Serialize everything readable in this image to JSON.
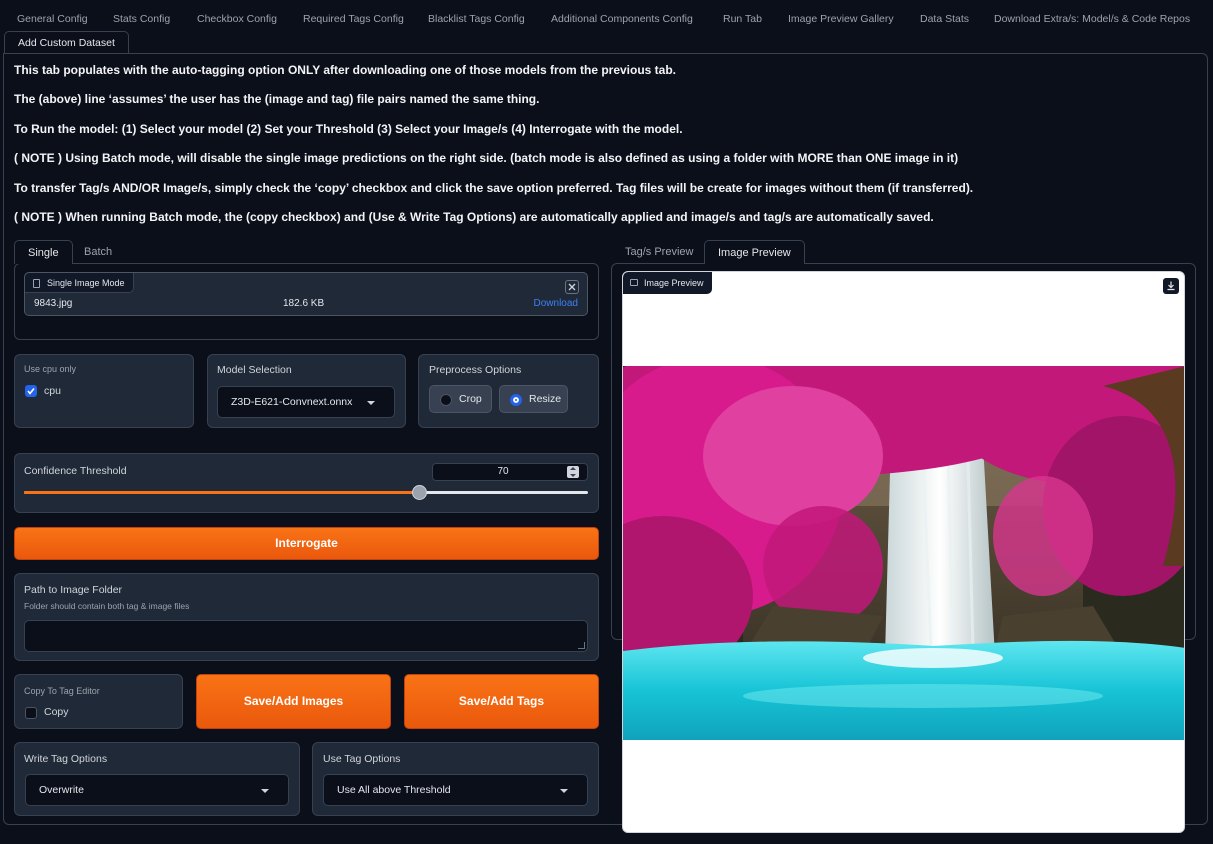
{
  "top_tabs": [
    {
      "label": "General Config",
      "active": false
    },
    {
      "label": "Stats Config",
      "active": false
    },
    {
      "label": "Checkbox Config",
      "active": false
    },
    {
      "label": "Required Tags Config",
      "active": false
    },
    {
      "label": "Blacklist Tags Config",
      "active": false
    },
    {
      "label": "Additional Components Config",
      "active": false
    },
    {
      "label": "Run Tab",
      "active": false
    },
    {
      "label": "Image Preview Gallery",
      "active": false
    },
    {
      "label": "Data Stats",
      "active": false
    },
    {
      "label": "Download Extra/s: Model/s & Code Repos",
      "active": false
    },
    {
      "label": "Add Custom Dataset",
      "active": true
    }
  ],
  "notes": [
    "This tab populates with the auto-tagging option ONLY after downloading one of those models from the previous tab.",
    "The (above) line ‘assumes’ the user has the (image and tag) file pairs named the same thing.",
    "To Run the model: (1) Select your model (2) Set your Threshold (3) Select your Image/s (4) Interrogate with the model.",
    "( NOTE ) Using Batch mode, will disable the single image predictions on the right side. (batch mode is also defined as using a folder with MORE than ONE image in it)",
    "To transfer Tag/s AND/OR Image/s, simply check the ‘copy’ checkbox and click the save option preferred. Tag files will be create for images without them (if transferred).",
    "( NOTE ) When running Batch mode, the (copy checkbox) and (Use & Write Tag Options) are automatically applied and image/s and tag/s are automatically saved."
  ],
  "left_tabs": {
    "single": "Single",
    "batch": "Batch"
  },
  "file_upload": {
    "badge": "Single Image Mode",
    "filename": "9843.jpg",
    "size": "182.6 KB",
    "download": "Download"
  },
  "cpu": {
    "label": "Use cpu only",
    "option": "cpu",
    "checked": true
  },
  "model": {
    "label": "Model Selection",
    "value": "Z3D-E621-Convnext.onnx"
  },
  "preprocess": {
    "label": "Preprocess Options",
    "options": [
      {
        "label": "Crop",
        "selected": false
      },
      {
        "label": "Resize",
        "selected": true
      }
    ]
  },
  "threshold": {
    "label": "Confidence Threshold",
    "value": "70",
    "fraction": 0.7
  },
  "interrogate_label": "Interrogate",
  "folder": {
    "label": "Path to Image Folder",
    "info": "Folder should contain both tag & image files",
    "value": ""
  },
  "copy": {
    "label": "Copy To Tag Editor",
    "option": "Copy",
    "checked": false
  },
  "buttons": {
    "save_images": "Save/Add Images",
    "save_tags": "Save/Add Tags"
  },
  "write_tag": {
    "label": "Write Tag Options",
    "value": "Overwrite"
  },
  "use_tag": {
    "label": "Use Tag Options",
    "value": "Use All above Threshold"
  },
  "right_tabs": {
    "tags": "Tag/s Preview",
    "image": "Image Preview"
  },
  "image_preview": {
    "badge": "Image Preview"
  },
  "colors": {
    "accent": "#f97316",
    "background": "#0b0f19",
    "panel": "#1f2937",
    "check": "#2563eb"
  }
}
